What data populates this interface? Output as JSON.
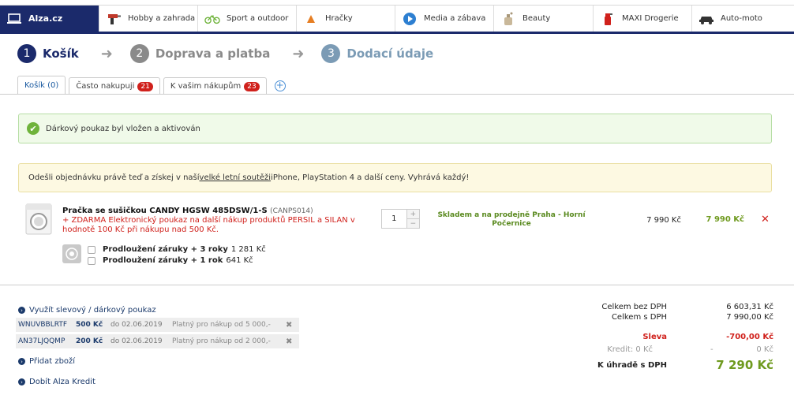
{
  "nav": [
    {
      "label": "Alza.cz",
      "icon": "laptop-icon"
    },
    {
      "label": "Hobby a zahrada",
      "icon": "drill-icon"
    },
    {
      "label": "Sport a outdoor",
      "icon": "bicycle-icon"
    },
    {
      "label": "Hračky",
      "icon": "toy-icon"
    },
    {
      "label": "Media a zábava",
      "icon": "play-icon"
    },
    {
      "label": "Beauty",
      "icon": "perfume-icon"
    },
    {
      "label": "MAXI Drogerie",
      "icon": "spray-icon"
    },
    {
      "label": "Auto-moto",
      "icon": "car-icon"
    }
  ],
  "steps": [
    {
      "num": "1",
      "label": "Košík"
    },
    {
      "num": "2",
      "label": "Doprava a platba"
    },
    {
      "num": "3",
      "label": "Dodací údaje"
    }
  ],
  "tabs": [
    {
      "label": "Košík (0)"
    },
    {
      "label": "Často nakupuji",
      "badge": "21"
    },
    {
      "label": "K vašim nákupům",
      "badge": "23"
    }
  ],
  "success_msg": "Dárkový poukaz byl vložen a aktivován",
  "promo": {
    "before": "Odešli objednávku právě teď a získej v naší ",
    "link": "velké letní soutěži",
    "after": " iPhone, PlayStation 4 a další ceny. Vyhrává každý!"
  },
  "product": {
    "name": "Pračka se sušičkou CANDY HGSW 485DSW/1-S",
    "code": "(CANPS014)",
    "gift": "+ ZDARMA Elektronický poukaz na další nákup produktů PERSIL a SILAN v hodnotě 100 Kč při nákupu nad 500 Kč.",
    "qty": "1",
    "stock": "Skladem a na prodejně Praha - Horní Počernice",
    "unit_price": "7 990 Kč",
    "total_price": "7 990 Kč",
    "warranties": [
      {
        "label": "Prodloužení záruky + 3 roky",
        "price": "1 281 Kč"
      },
      {
        "label": "Prodloužení záruky + 1 rok",
        "price": "641 Kč"
      }
    ]
  },
  "voucher_link": "Využít slevový / dárkový poukaz",
  "vouchers": [
    {
      "code": "WNUVBBLRTF",
      "amount": "500 Kč",
      "date": "do 02.06.2019",
      "valid": "Platný pro nákup od 5 000,-"
    },
    {
      "code": "AN37LJQQMP",
      "amount": "200 Kč",
      "date": "do 02.06.2019",
      "valid": "Platný pro nákup od 2 000,-"
    }
  ],
  "add_item": "Přidat zboží",
  "credit_link": "Dobít Alza Kredit",
  "totals": {
    "no_vat_label": "Celkem bez DPH",
    "no_vat": "6 603,31 Kč",
    "vat_label": "Celkem s DPH",
    "vat": "7 990,00 Kč",
    "discount_label": "Sleva",
    "discount": "-700,00 Kč",
    "credit_label": "Kredit: 0 Kč",
    "credit_dash": "-",
    "credit": "0 Kč",
    "final_label": "K úhradě s DPH",
    "final": "7 290 Kč"
  },
  "colors": {
    "brand": "#1b2a6b",
    "red": "#d0211c",
    "green": "#6f9a1f"
  }
}
